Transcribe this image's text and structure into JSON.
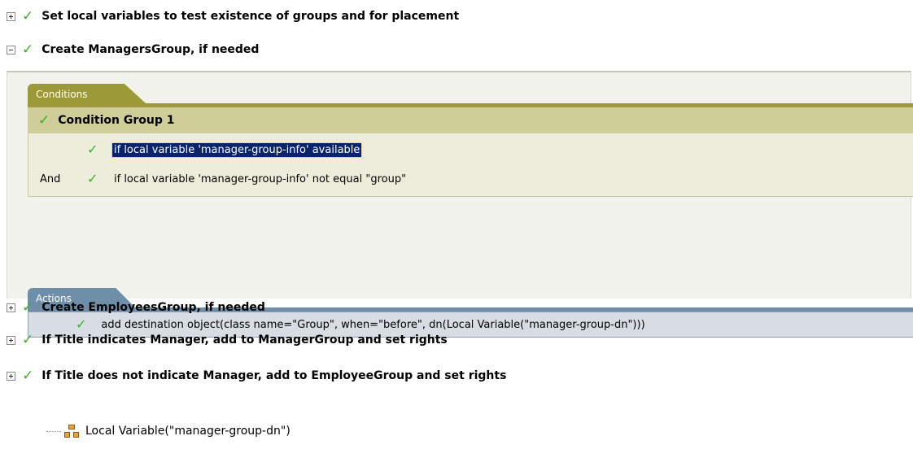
{
  "colors": {
    "check": "#3fae2a",
    "conditions_tab": "#9c9a38",
    "condition_group_header": "#cfcd98",
    "actions_tab": "#6f8fa8",
    "selection": "#0a246a"
  },
  "rules": [
    {
      "label": "Set local variables to test existence of groups and for placement",
      "expanded": false
    },
    {
      "label": "Create ManagersGroup, if needed",
      "expanded": true
    },
    {
      "label": "Create EmployeesGroup, if needed",
      "expanded": false
    },
    {
      "label": "If Title indicates Manager, add to ManagerGroup and set rights",
      "expanded": false
    },
    {
      "label": "If Title does not indicate Manager, add to EmployeeGroup and set rights",
      "expanded": false
    }
  ],
  "conditions": {
    "tab_label": "Conditions",
    "group_label": "Condition Group 1",
    "rows": [
      {
        "logic": "",
        "text": "if local variable 'manager-group-info' available",
        "selected": true
      },
      {
        "logic": "And",
        "text": "if local variable 'manager-group-info' not equal \"group\"",
        "selected": false
      }
    ]
  },
  "actions": {
    "tab_label": "Actions",
    "rows": [
      {
        "text": "add destination object(class name=\"Group\", when=\"before\", dn(Local Variable(\"manager-group-dn\")))"
      }
    ]
  },
  "variable_node": {
    "label": "Local Variable(\"manager-group-dn\")",
    "icon": "hierarchy-icon"
  }
}
